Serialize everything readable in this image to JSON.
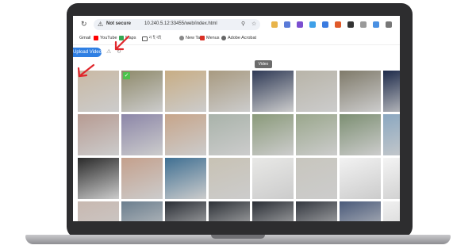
{
  "browser": {
    "security_label": "Not secure",
    "url": "10.240.5.12:33455/web/index.html"
  },
  "bookmarks": [
    {
      "label": "Gmail",
      "icon": "gmail-icon",
      "color": "#ea4335"
    },
    {
      "label": "YouTube",
      "icon": "youtube-icon",
      "color": "#ff0000"
    },
    {
      "label": "Maps",
      "icon": "maps-icon",
      "color": "#34a853"
    },
    {
      "label": "ন ই বই",
      "icon": "folder-icon",
      "color": "#444444"
    },
    {
      "label": "New Tab",
      "icon": "new-tab-icon",
      "color": "#666666"
    },
    {
      "label": "Menus",
      "icon": "menus-icon",
      "color": "#d93025"
    },
    {
      "label": "Adobe Acrobat",
      "icon": "acrobat-icon",
      "color": "#444444"
    }
  ],
  "toolbar": {
    "upload_label": "Upload Video",
    "tooltip": "Video"
  },
  "colors": {
    "accent": "#2f7fe3",
    "arrow": "#e0262b",
    "check": "#4cc24c"
  },
  "gallery": {
    "selected_index": 1,
    "tiles": [
      "#c9b9a4",
      "#8f8a6b",
      "#c8ad84",
      "#a89a80",
      "#2f3a56",
      "#b8b4a8",
      "#7f7a6a",
      "#1d2a4a",
      "#b79b92",
      "#8c86a8",
      "#c7a58a",
      "#a9b3aa",
      "#8a9a7a",
      "#9aa78c",
      "#7c8f72",
      "#8aa7c0",
      "#2a2a2a",
      "#c4a08c",
      "#3f6f92",
      "#c8c2b4",
      "#e8e8e6",
      "#c8c6be",
      "#f2f2f2",
      "#f4f4f4",
      "#c8b8b0",
      "#6b7e8e",
      "#2b2f36",
      "#2e3238",
      "#2b2f36",
      "#343840",
      "#4a5a7a",
      "#f0f0f0"
    ]
  }
}
